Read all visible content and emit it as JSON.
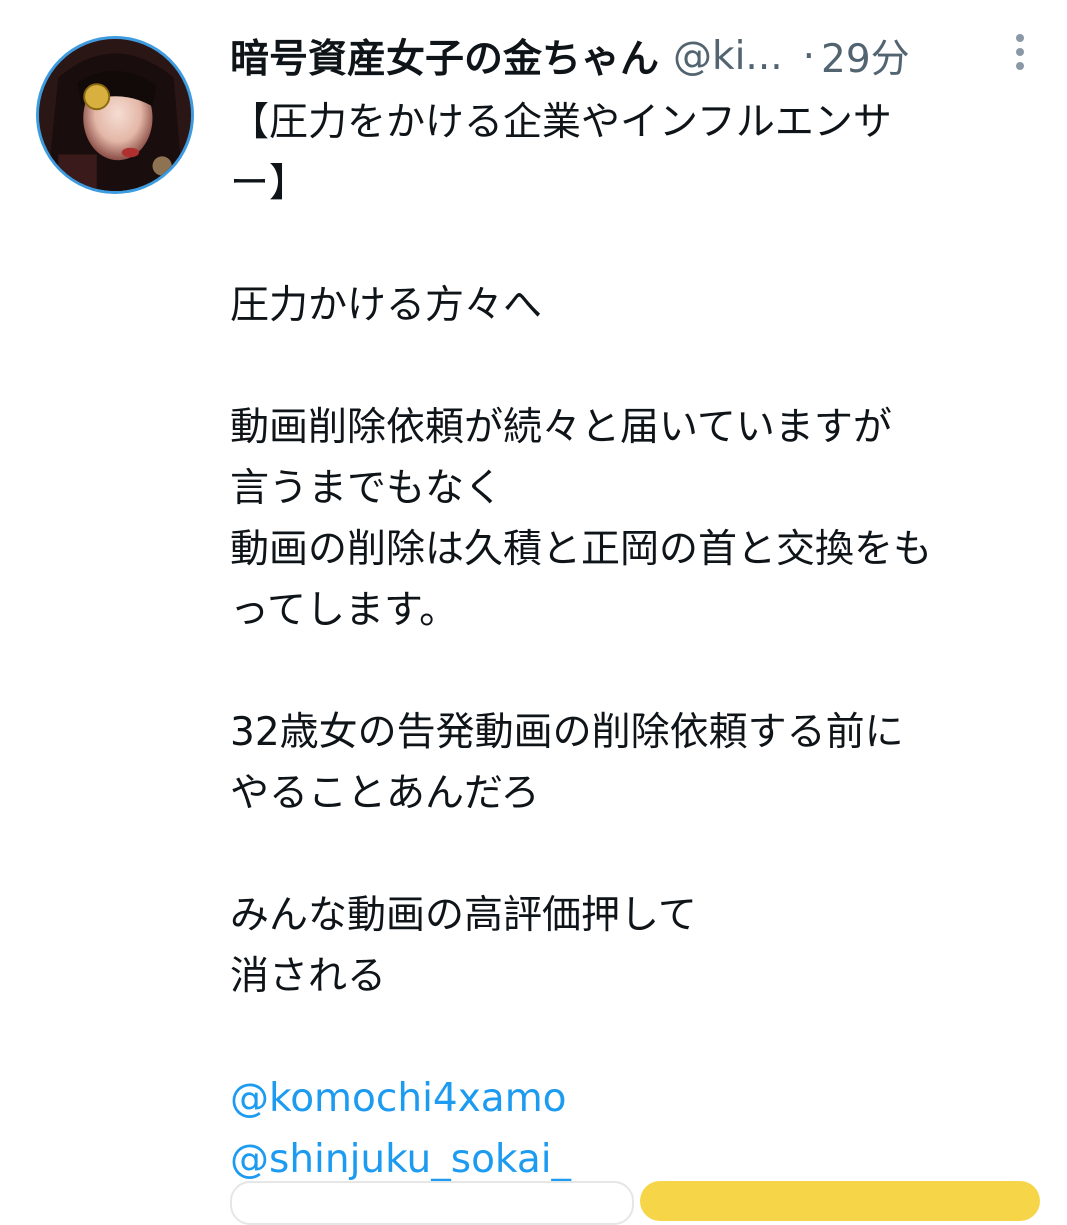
{
  "tweet": {
    "display_name": "暗号資産女子の金ちゃん",
    "handle": "@ki...",
    "separator": "·",
    "time": "29分",
    "lines": [
      "【圧力をかける企業やインフルエンサ",
      "ー】",
      "",
      "圧力かける方々へ",
      "",
      "動画削除依頼が続々と届いていますが",
      "言うまでもなく",
      "動画の削除は久積と正岡の首と交換をも",
      "ってします。",
      "",
      "32歳女の告発動画の削除依頼する前に",
      "やることあんだろ",
      "",
      "みんな動画の高評価押して",
      "消される",
      ""
    ],
    "mentions": [
      "@komochi4xamo",
      "@shinjuku_sokai_"
    ]
  },
  "icons": {
    "more": "more-vertical-icon",
    "avatar": "profile-avatar"
  },
  "colors": {
    "mention": "#1d9bf0",
    "secondary_text": "#536471",
    "avatar_ring": "#3d9be0",
    "accent_button": "#f7d548"
  }
}
